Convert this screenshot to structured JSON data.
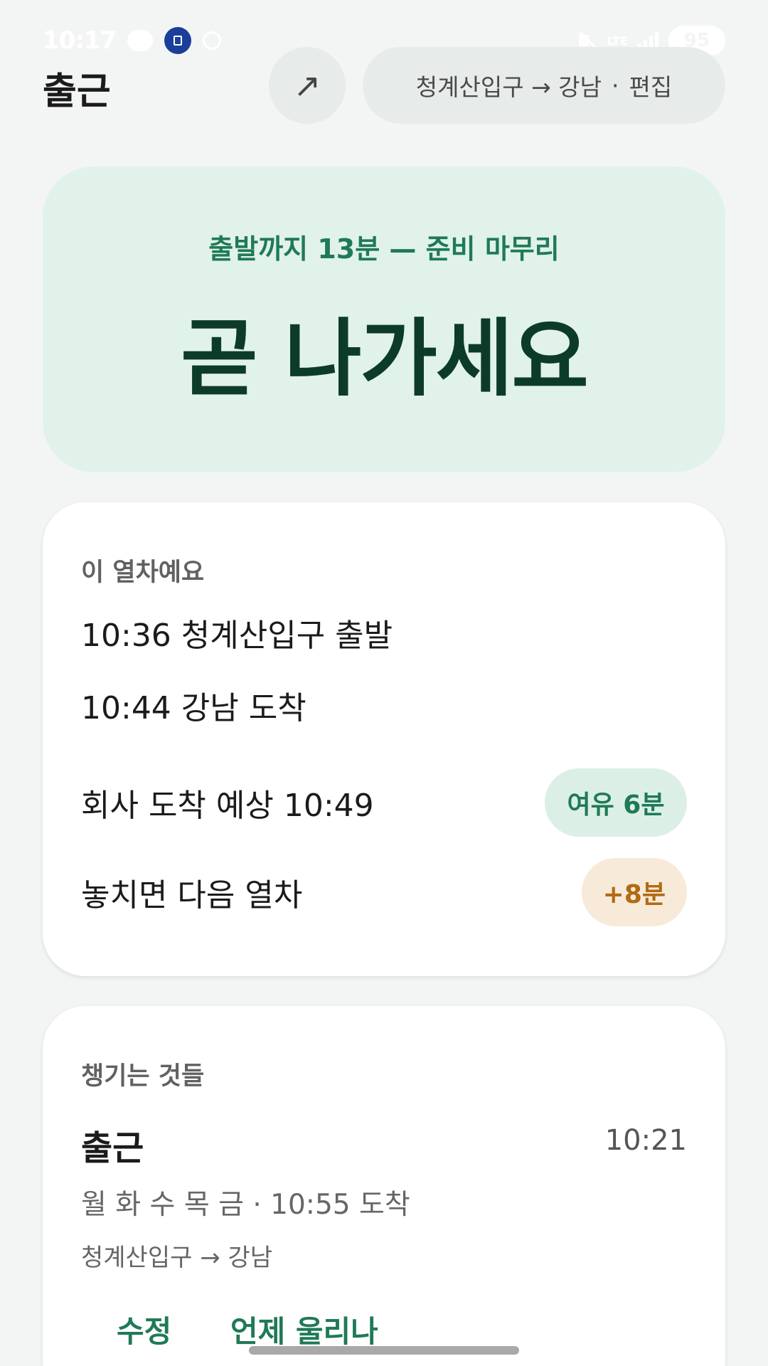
{
  "status_bar": {
    "time": "10:17",
    "network": "LTE",
    "battery": "95",
    "icons": [
      "chat-icon",
      "app-icon",
      "location-icon",
      "mute-icon",
      "signal-icon",
      "battery-icon"
    ]
  },
  "header": {
    "title": "출근",
    "share_icon": "↗",
    "route": "청계산입구 → 강남",
    "separator": "·",
    "edit_label": "편집"
  },
  "hero": {
    "subtitle": "출발까지 13분 — 준비 마무리",
    "title": "곧 나가세요",
    "background": "#e1f2ea",
    "accent": "#1f7a56"
  },
  "train_card": {
    "label": "이 열차예요",
    "departure": "10:36 청계산입구 출발",
    "arrival": "10:44 강남 도착",
    "office_arrival": "회사 도착 예상 10:49",
    "slack_badge": "여유 6분",
    "missed_text": "놓치면 다음 열차",
    "missed_badge": "+8분"
  },
  "items_card": {
    "label": "챙기는 것들",
    "routine_name": "출근",
    "routine_time": "10:21",
    "days": "월 화 수 목 금 · 10:55 도착",
    "route": "청계산입구 → 강남",
    "edit_button": "수정",
    "when_alert_button": "언제 울리나"
  }
}
